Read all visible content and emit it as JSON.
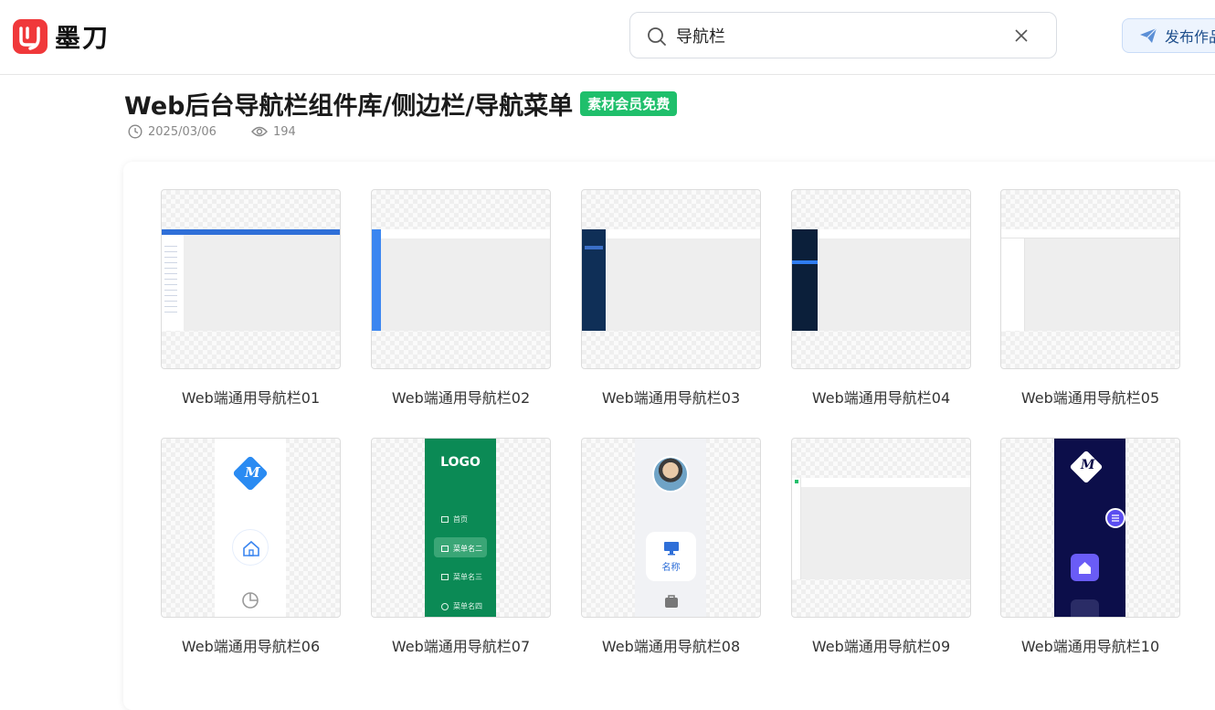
{
  "app": {
    "logo_text": "墨刀",
    "brand_color": "#f0383a"
  },
  "search": {
    "value": "导航栏",
    "placeholder": ""
  },
  "header": {
    "publish_label": "发布作品"
  },
  "page": {
    "title": "Web后台导航栏组件库/侧边栏/导航菜单",
    "badge": "素材会员免费",
    "date": "2025/03/06",
    "views": "194"
  },
  "cards": [
    {
      "label": "Web端通用导航栏01"
    },
    {
      "label": "Web端通用导航栏02"
    },
    {
      "label": "Web端通用导航栏03"
    },
    {
      "label": "Web端通用导航栏04"
    },
    {
      "label": "Web端通用导航栏05"
    },
    {
      "label": "Web端通用导航栏06"
    },
    {
      "label": "Web端通用导航栏07",
      "logo": "LOGO",
      "menu": [
        "首页",
        "菜单名二",
        "菜单名三",
        "菜单名四"
      ]
    },
    {
      "label": "Web端通用导航栏08",
      "tile_label": "名称"
    },
    {
      "label": "Web端通用导航栏09"
    },
    {
      "label": "Web端通用导航栏10"
    }
  ]
}
